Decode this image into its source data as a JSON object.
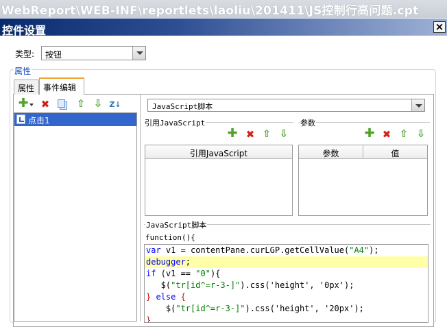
{
  "path_strip": "WebReport\\WEB-INF\\reportlets\\laoliu\\201411\\JS控制行高问题.cpt",
  "dialog": {
    "title": "控件设置",
    "close_label": "×"
  },
  "type_field": {
    "label": "类型:",
    "value": "按钮"
  },
  "properties_group": {
    "title": "属性"
  },
  "tabs": [
    {
      "label": "属性",
      "active": false
    },
    {
      "label": "事件编辑",
      "active": true
    }
  ],
  "left_toolbar": {
    "icons": [
      "add-icon",
      "delete-icon",
      "copy-icon",
      "move-up-icon",
      "move-down-icon",
      "sort-icon"
    ]
  },
  "event_list": {
    "items": [
      {
        "label": "点击1",
        "selected": true
      }
    ]
  },
  "script_type_select": {
    "value": "JavaScript脚本"
  },
  "ref_js_section": {
    "label": "引用JavaScript",
    "table_header": "引用JavaScript"
  },
  "params_section": {
    "label": "参数",
    "columns": [
      "参数",
      "值"
    ]
  },
  "script_section": {
    "label": "JavaScript脚本",
    "function_header": "function(){"
  },
  "code": {
    "lines": [
      {
        "parts": [
          {
            "t": "var",
            "c": "kw"
          },
          {
            "t": " v1 = contentPane.curLGP.getCellValue(",
            "c": ""
          },
          {
            "t": "\"A4\"",
            "c": "str"
          },
          {
            "t": ");",
            "c": ""
          }
        ],
        "highlight": false
      },
      {
        "parts": [
          {
            "t": "debugger",
            "c": "kw"
          },
          {
            "t": ";",
            "c": ""
          }
        ],
        "highlight": true
      },
      {
        "parts": [
          {
            "t": "if",
            "c": "kw"
          },
          {
            "t": " (v1 == ",
            "c": ""
          },
          {
            "t": "\"0\"",
            "c": "str"
          },
          {
            "t": "){",
            "c": ""
          }
        ],
        "highlight": false
      },
      {
        "parts": [
          {
            "t": "   $(",
            "c": ""
          },
          {
            "t": "\"tr[id^=r-3-]\"",
            "c": "str"
          },
          {
            "t": ").css('height', '0px');",
            "c": ""
          }
        ],
        "highlight": false
      },
      {
        "parts": [
          {
            "t": "}",
            "c": "red"
          },
          {
            "t": " else ",
            "c": "kw"
          },
          {
            "t": "{",
            "c": "red"
          }
        ],
        "highlight": false
      },
      {
        "parts": [
          {
            "t": "    $(",
            "c": ""
          },
          {
            "t": "\"tr[id^=r-3-]\"",
            "c": "str"
          },
          {
            "t": ").css('height', '20px');",
            "c": ""
          }
        ],
        "highlight": false
      },
      {
        "parts": [
          {
            "t": "}",
            "c": "red"
          }
        ],
        "highlight": false
      }
    ]
  },
  "colors": {
    "title_bar_start": "#0a2a6e",
    "selection": "#3366cc",
    "group_title": "#1a4fb5",
    "tab_accent": "#f0a431",
    "line_highlight": "#ffffa8"
  }
}
